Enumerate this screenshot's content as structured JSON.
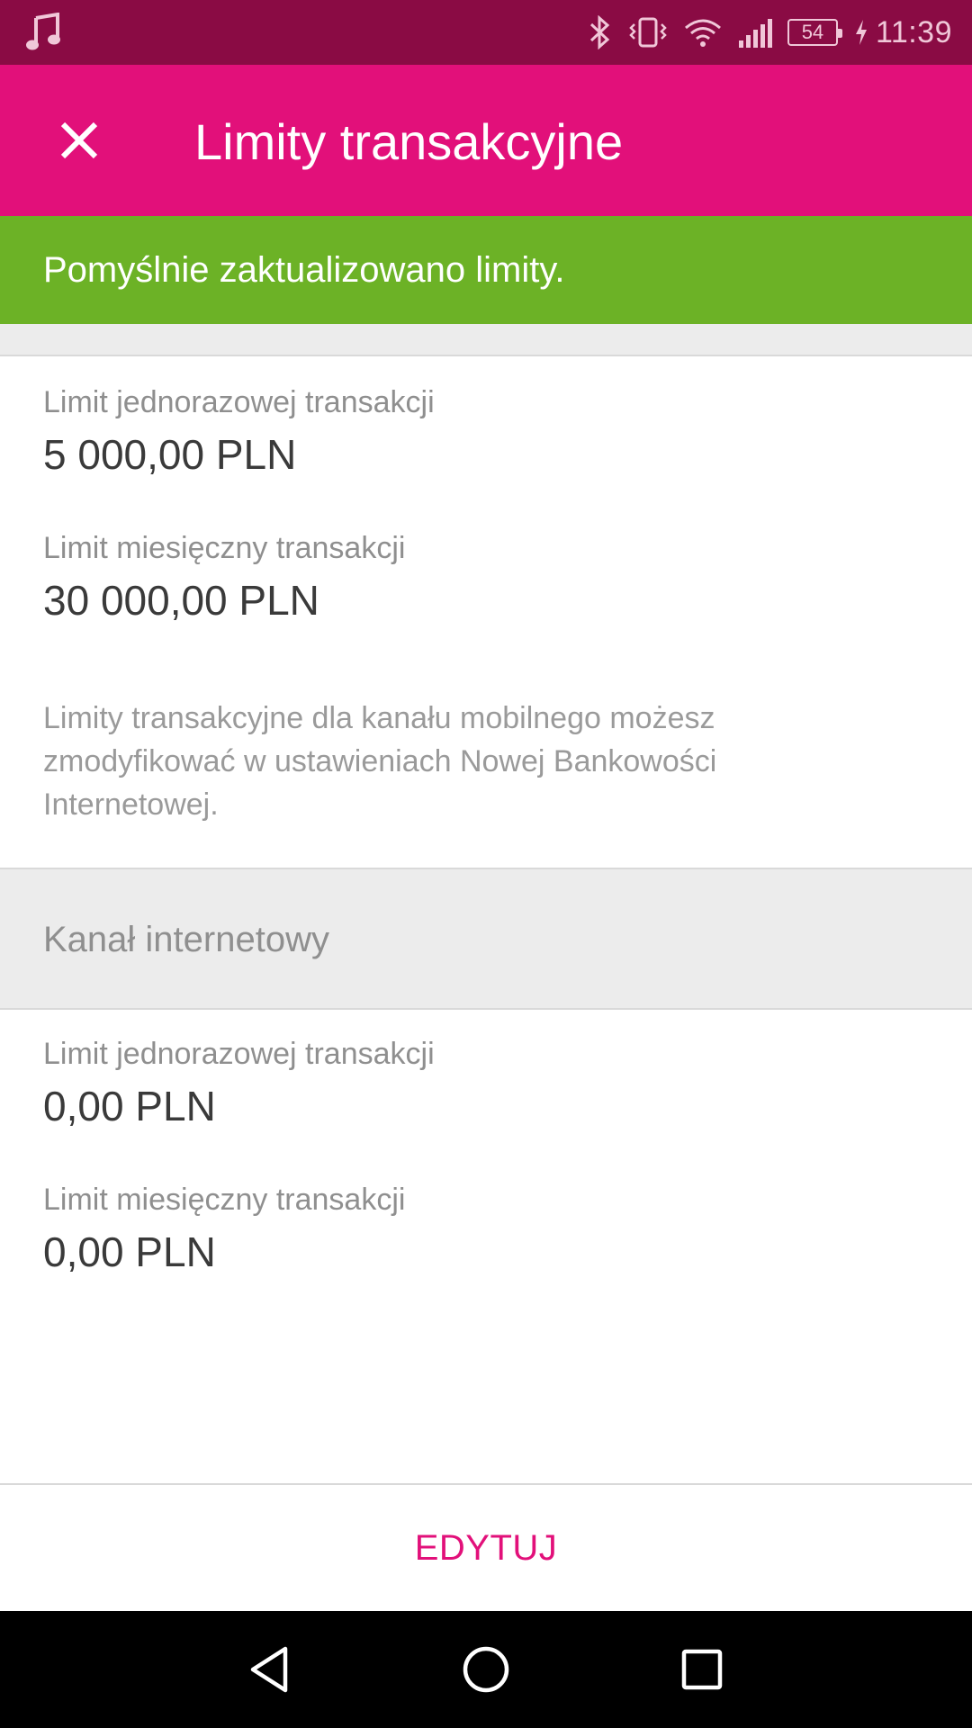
{
  "status_bar": {
    "battery": "54",
    "time": "11:39"
  },
  "app_bar": {
    "title": "Limity transakcyjne"
  },
  "banner": {
    "message": "Pomyślnie zaktualizowano limity."
  },
  "mobile_channel": {
    "single_label": "Limit jednorazowej transakcji",
    "single_value": "5 000,00 PLN",
    "monthly_label": "Limit miesięczny transakcji",
    "monthly_value": "30 000,00 PLN",
    "note": "Limity transakcyjne dla kanału mobilnego możesz zmodyfikować w ustawieniach Nowej Bankowości Internetowej."
  },
  "internet_channel": {
    "header": "Kanał internetowy",
    "single_label": "Limit jednorazowej transakcji",
    "single_value": "0,00 PLN",
    "monthly_label": "Limit miesięczny transakcji",
    "monthly_value": "0,00 PLN"
  },
  "footer": {
    "edit_label": "EDYTUJ"
  },
  "colors": {
    "status_bar": "#8a0b44",
    "app_bar": "#e2107a",
    "success": "#6cb226",
    "accent": "#e2107a"
  },
  "icons": [
    "music-note-icon",
    "bluetooth-icon",
    "vibrate-icon",
    "wifi-icon",
    "signal-icon",
    "battery-icon",
    "charging-icon",
    "close-icon",
    "back-icon",
    "home-icon",
    "recents-icon"
  ]
}
